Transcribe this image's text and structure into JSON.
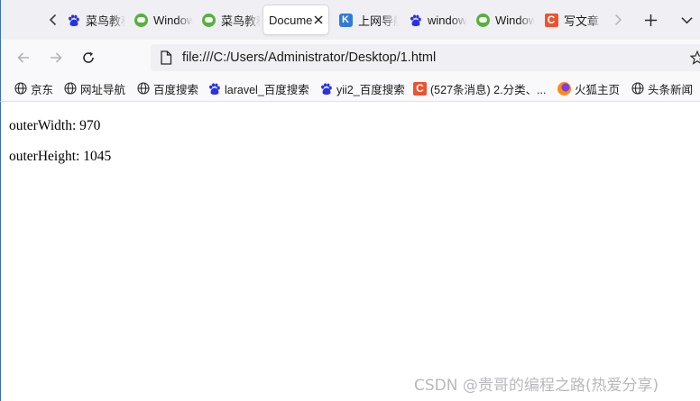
{
  "tabs": [
    {
      "title": "菜鸟教程",
      "icon": "baidu-paw-icon",
      "active": false
    },
    {
      "title": "Windows",
      "icon": "wechat-icon",
      "active": false
    },
    {
      "title": "菜鸟教程",
      "icon": "wechat-icon",
      "active": false
    },
    {
      "title": "Document",
      "icon": "none",
      "active": true
    },
    {
      "title": "上网导航",
      "icon": "k-shield-icon",
      "active": false
    },
    {
      "title": "windows",
      "icon": "baidu-paw-icon",
      "active": false
    },
    {
      "title": "Windows",
      "icon": "wechat-icon",
      "active": false
    },
    {
      "title": "写文章",
      "icon": "csdn-icon",
      "active": false
    }
  ],
  "nav": {
    "url": "file:///C:/Users/Administrator/Desktop/1.html"
  },
  "bookmarks": [
    {
      "label": "京东",
      "icon": "globe-icon"
    },
    {
      "label": "网址导航",
      "icon": "globe-icon"
    },
    {
      "label": "百度搜索",
      "icon": "globe-icon"
    },
    {
      "label": "laravel_百度搜索",
      "icon": "baidu-paw-icon"
    },
    {
      "label": "yii2_百度搜索",
      "icon": "baidu-paw-icon"
    },
    {
      "label": "(527条消息) 2.分类、...",
      "icon": "csdn-icon"
    },
    {
      "label": "火狐主页",
      "icon": "firefox-icon"
    },
    {
      "label": "头条新闻",
      "icon": "globe-icon"
    }
  ],
  "content": {
    "lines": [
      "outerWidth: 970",
      "outerHeight: 1045"
    ]
  },
  "watermark": "CSDN @贵哥的编程之路(热爱分享)",
  "colors": {
    "tabstrip_bg": "#f0f0f4",
    "csdn_red": "#f0512e",
    "baidu_blue": "#2932e1",
    "wechat_green": "#55b23a"
  }
}
